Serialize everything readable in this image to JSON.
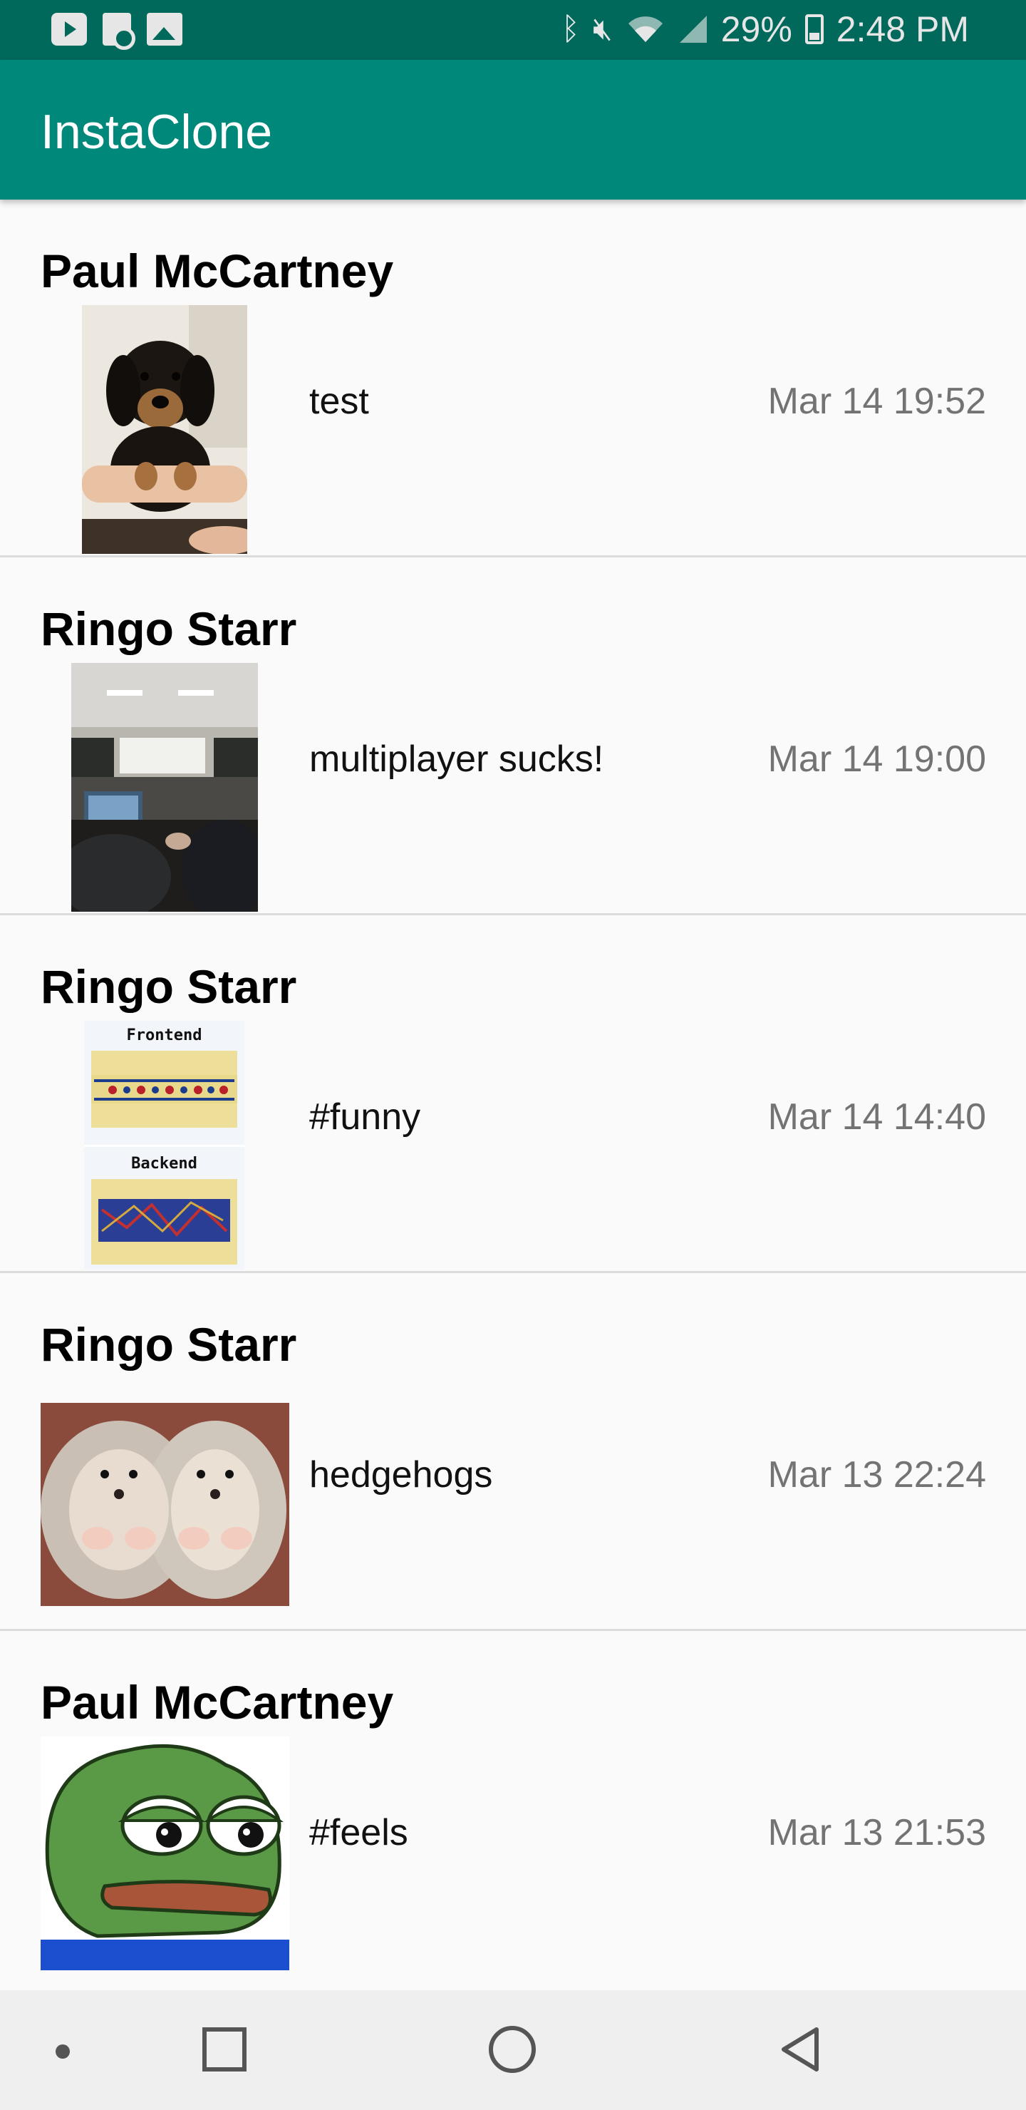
{
  "status_bar": {
    "battery": "29%",
    "time": "2:48 PM",
    "icons": [
      "youtube-icon",
      "document-icon",
      "image-icon",
      "bluetooth-icon",
      "mute-icon",
      "wifi-icon",
      "signal-icon",
      "battery-icon"
    ]
  },
  "app_bar": {
    "title": "InstaClone"
  },
  "posts": [
    {
      "author": "Paul McCartney",
      "caption": "test",
      "time": "Mar 14 19:52",
      "image": "puppy-photo"
    },
    {
      "author": "Ringo Starr",
      "caption": "multiplayer sucks!",
      "time": "Mar 14 19:00",
      "image": "lecture-hall-photo"
    },
    {
      "author": "Ringo Starr",
      "caption": "#funny",
      "time": "Mar 14 14:40",
      "image": "frontend-backend-meme",
      "image_text": {
        "top": "Frontend",
        "bottom": "Backend"
      }
    },
    {
      "author": "Ringo Starr",
      "caption": "hedgehogs",
      "time": "Mar 13 22:24",
      "image": "hedgehogs-photo"
    },
    {
      "author": "Paul McCartney",
      "caption": "#feels",
      "time": "Mar 13 21:53",
      "image": "pepe-frog"
    }
  ],
  "nav_bar": {
    "icons": [
      "dot-icon",
      "recents-square-icon",
      "home-circle-icon",
      "back-triangle-icon"
    ]
  },
  "colors": {
    "status_bar": "#00695c",
    "app_bar": "#00897b",
    "background": "#fafafa",
    "timestamp": "#737373"
  }
}
